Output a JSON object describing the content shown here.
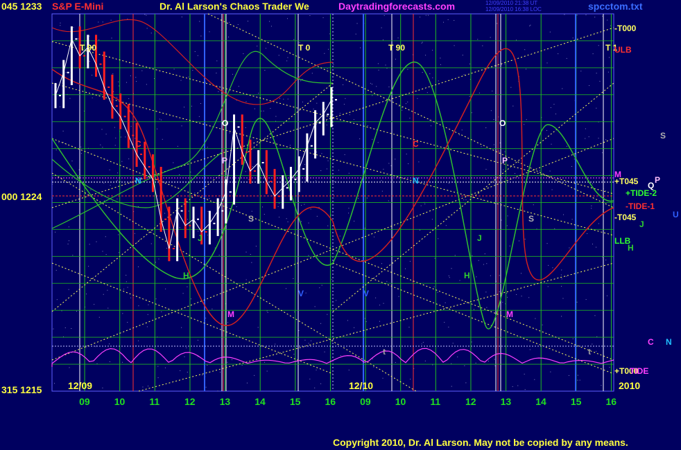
{
  "header": {
    "code_pair": "045 1233",
    "instrument": "S&P E-Mini",
    "title": "Dr. Al Larson's Chaos Trader We",
    "site": "Daytradingforecasts.com",
    "stamp_line1": "12/09/2010 21:38 UT",
    "stamp_line2": "12/09/2010 16:38 LOC",
    "filename": "spcctom.txt"
  },
  "price_labels": {
    "mid": "000  1224",
    "bottom": "315  1215"
  },
  "footer": {
    "date_left": "12/09",
    "date_mid": "12/10",
    "year": "2010",
    "copyright": "Copyright 2010, Dr. Al Larson. May not be copied by any means."
  },
  "colors": {
    "background": "#000060",
    "grid_green": "#20c020",
    "diag_yellow": "#ffff60",
    "price_white": "#ffffff",
    "price_red": "#ff2020",
    "tide_magenta": "#ff40ff"
  },
  "chart_data": {
    "type": "line",
    "title": "S&P E-Mini",
    "ylim": [
      1215,
      1233
    ],
    "y_ticks": [
      1233,
      1224,
      1215
    ],
    "x_ticks": [
      "09",
      "10",
      "11",
      "12",
      "13",
      "14",
      "15",
      "16",
      "09",
      "10",
      "11",
      "12",
      "13",
      "14",
      "15",
      "16"
    ],
    "date_labels": [
      "12/09",
      "12/10"
    ],
    "price_series": [
      {
        "x": 0.0,
        "y": 1229.1
      },
      {
        "x": 0.2,
        "y": 1230.2
      },
      {
        "x": 0.4,
        "y": 1231.8
      },
      {
        "x": 0.6,
        "y": 1231.0
      },
      {
        "x": 0.8,
        "y": 1231.4
      },
      {
        "x": 1.0,
        "y": 1230.6
      },
      {
        "x": 1.2,
        "y": 1229.5
      },
      {
        "x": 1.4,
        "y": 1228.6
      },
      {
        "x": 1.6,
        "y": 1228.1
      },
      {
        "x": 1.8,
        "y": 1227.2
      },
      {
        "x": 2.0,
        "y": 1226.3
      },
      {
        "x": 2.2,
        "y": 1225.7
      },
      {
        "x": 2.4,
        "y": 1225.1
      },
      {
        "x": 2.6,
        "y": 1223.2
      },
      {
        "x": 2.8,
        "y": 1221.8
      },
      {
        "x": 3.0,
        "y": 1223.6
      },
      {
        "x": 3.2,
        "y": 1222.9
      },
      {
        "x": 3.4,
        "y": 1223.2
      },
      {
        "x": 3.6,
        "y": 1222.6
      },
      {
        "x": 3.8,
        "y": 1223.0
      },
      {
        "x": 4.0,
        "y": 1223.6
      },
      {
        "x": 4.2,
        "y": 1224.5
      },
      {
        "x": 4.4,
        "y": 1227.6
      },
      {
        "x": 4.6,
        "y": 1226.4
      },
      {
        "x": 4.8,
        "y": 1225.5
      },
      {
        "x": 5.0,
        "y": 1225.9
      },
      {
        "x": 5.2,
        "y": 1225.0
      },
      {
        "x": 5.4,
        "y": 1224.3
      },
      {
        "x": 5.6,
        "y": 1224.7
      },
      {
        "x": 5.8,
        "y": 1225.1
      },
      {
        "x": 6.0,
        "y": 1225.6
      },
      {
        "x": 6.2,
        "y": 1226.7
      },
      {
        "x": 6.4,
        "y": 1227.8
      },
      {
        "x": 6.6,
        "y": 1228.2
      },
      {
        "x": 6.8,
        "y": 1228.9
      }
    ],
    "markers": {
      "T": [
        "T  90",
        "T  0",
        "T  90",
        "T  1"
      ],
      "planets": [
        "C",
        "N",
        "J",
        "H",
        "S",
        "O",
        "P",
        "M",
        "V",
        "t",
        "C",
        "N",
        "J",
        "H",
        "S",
        "O",
        "P",
        "M",
        "V",
        "t"
      ],
      "right_labels": [
        "-T000",
        "ULB",
        "M",
        "+T045",
        "+TIDE-2",
        "-TIDE-1",
        "-T045",
        "LLB",
        "+T000",
        "TIDE"
      ],
      "right_planets": [
        "S",
        "Q",
        "P",
        "J",
        "H",
        "U",
        "C",
        "N"
      ]
    }
  }
}
